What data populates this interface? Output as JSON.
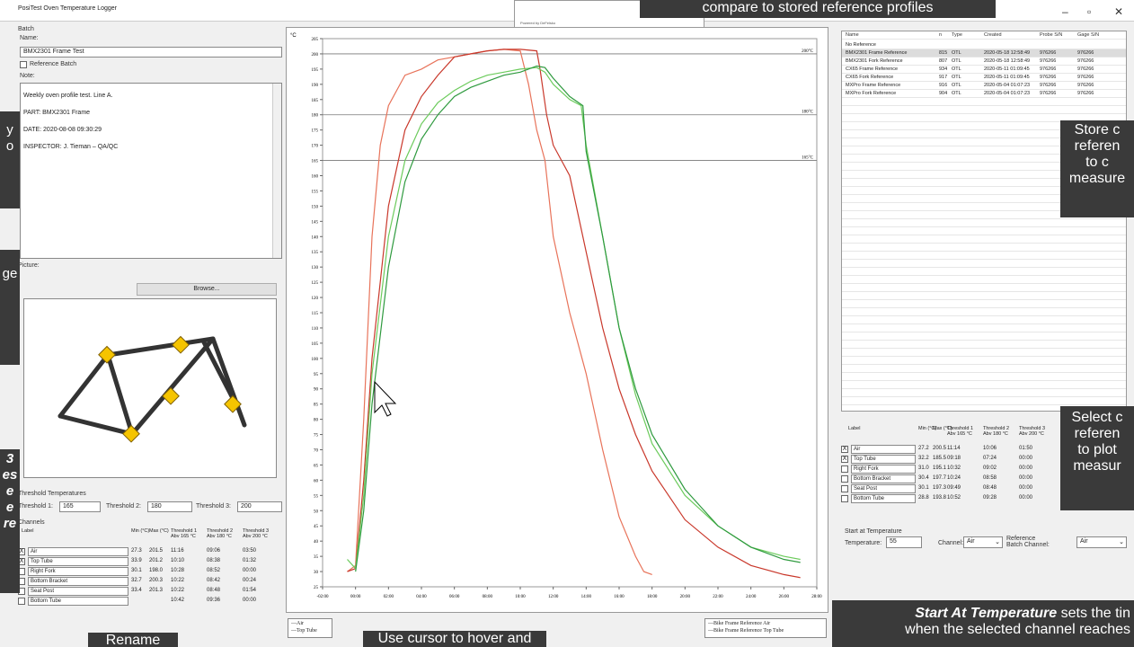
{
  "window": {
    "title": "PosiTest Oven Temperature Logger",
    "min": "–",
    "max": "▫",
    "close": "✕"
  },
  "batch": {
    "group": "Batch",
    "name_label": "Name:",
    "name_value": "BMX2301 Frame Test",
    "reference_batch_label": "Reference Batch",
    "note_label": "Note:",
    "note_lines": [
      "Weekly oven profile test. Line A.",
      "PART: BMX2301 Frame",
      "DATE: 2020-08-08  09:30:29",
      "INSPECTOR: J. Tieman – QA/QC"
    ],
    "picture_label": "Picture:",
    "browse_label": "Browse..."
  },
  "thresholds": {
    "group": "Threshold Temperatures",
    "t1_label": "Threshold 1:",
    "t1_value": "165",
    "t2_label": "Threshold 2:",
    "t2_value": "180",
    "t3_label": "Threshold 3:",
    "t3_value": "200"
  },
  "channels": {
    "group": "Channels",
    "headers": [
      "Label",
      "Min (°C)",
      "Max (°C)",
      "Threshold 1 Abv 165 °C",
      "Threshold 2 Abv 180 °C",
      "Threshold 3 Abv 200 °C"
    ],
    "rows": [
      {
        "checked": "X",
        "label": "Air",
        "min": "27.3",
        "max": "201.5",
        "t1": "11:16",
        "t2": "09:06",
        "t3": "03:50"
      },
      {
        "checked": "X",
        "label": "Top Tube",
        "min": "33.9",
        "max": "201.2",
        "t1": "10:10",
        "t2": "08:38",
        "t3": "01:32"
      },
      {
        "checked": "",
        "label": "Right Fork",
        "min": "30.1",
        "max": "198.0",
        "t1": "10:28",
        "t2": "08:52",
        "t3": "00:00"
      },
      {
        "checked": "",
        "label": "Bottom Bracket",
        "min": "32.7",
        "max": "200.3",
        "t1": "10:22",
        "t2": "08:42",
        "t3": "00:24"
      },
      {
        "checked": "",
        "label": "Seat Post",
        "min": "33.4",
        "max": "201.3",
        "t1": "10:22",
        "t2": "08:48",
        "t3": "01:54"
      },
      {
        "checked": "",
        "label": "Bottom Tube",
        "min": "",
        "max": "",
        "t1": "10:42",
        "t2": "09:36",
        "t3": "00:00"
      }
    ]
  },
  "chart": {
    "ylabel": "°C",
    "threshold_labels": [
      "200°C",
      "180°C",
      "165°C"
    ],
    "legend_left": [
      "—Air",
      "—Top Tube"
    ],
    "legend_right": [
      "—Bike Frame Reference Air",
      "—Bike Frame Reference Top Tube"
    ],
    "top_strip_text": "Powered by DeFelsko"
  },
  "chart_data": {
    "type": "line",
    "xlabel": "",
    "ylabel": "°C",
    "x_ticks": [
      "-02:00",
      "00:00",
      "02:00",
      "04:00",
      "06:00",
      "08:00",
      "10:00",
      "12:00",
      "14:00",
      "16:00",
      "18:00",
      "20:00",
      "22:00",
      "24:00",
      "26:00",
      "28:00"
    ],
    "y_ticks": [
      25,
      30,
      35,
      40,
      45,
      50,
      55,
      60,
      65,
      70,
      75,
      80,
      85,
      90,
      95,
      100,
      105,
      110,
      115,
      120,
      125,
      130,
      135,
      140,
      145,
      150,
      155,
      160,
      165,
      170,
      175,
      180,
      185,
      190,
      195,
      200,
      205
    ],
    "xlim": [
      -2,
      28
    ],
    "ylim": [
      25,
      205
    ],
    "thresholds": [
      200,
      180,
      165
    ],
    "series": [
      {
        "color": "#e8735a",
        "x": [
          -0.5,
          0,
          0.5,
          1,
          1.5,
          2,
          2.5,
          3,
          4,
          5,
          6,
          7,
          8,
          9,
          10,
          10.5,
          11,
          11.5,
          12,
          13,
          14,
          15,
          16,
          17,
          17.5,
          18
        ],
        "y": [
          30,
          32,
          80,
          140,
          170,
          183,
          188,
          193,
          195,
          198,
          199,
          200,
          201,
          201.5,
          201,
          190,
          175,
          165,
          140,
          115,
          95,
          70,
          48,
          35,
          30,
          29
        ]
      },
      {
        "color": "#c9382b",
        "x": [
          -0.5,
          0,
          0.5,
          1,
          2,
          3,
          4,
          5,
          6,
          7,
          8,
          9,
          10,
          11,
          11.2,
          11.6,
          12,
          13,
          14,
          15,
          16,
          17,
          18,
          20,
          22,
          24,
          26,
          27
        ],
        "y": [
          30,
          31,
          60,
          100,
          150,
          175,
          186,
          193,
          199,
          200,
          201,
          201.5,
          201.5,
          201,
          195,
          180,
          170,
          160,
          135,
          110,
          90,
          75,
          63,
          47,
          38,
          32,
          29,
          28
        ]
      },
      {
        "color": "#6ccb5c",
        "x": [
          -0.5,
          0,
          0.5,
          1,
          2,
          3,
          4,
          5,
          6,
          7,
          8,
          9,
          10,
          11,
          11.5,
          12,
          13,
          13.7,
          14,
          15,
          16,
          17,
          18,
          20,
          22,
          24,
          26,
          27
        ],
        "y": [
          34,
          31,
          55,
          95,
          140,
          165,
          177,
          184,
          188,
          191,
          193,
          194,
          195,
          195.5,
          194,
          190,
          185,
          183,
          170,
          140,
          110,
          88,
          72,
          55,
          45,
          38,
          35,
          34
        ]
      },
      {
        "color": "#2e9a3e",
        "x": [
          0,
          0.5,
          1,
          2,
          3,
          4,
          5,
          6,
          7,
          8,
          9,
          10,
          11,
          11.5,
          12,
          13,
          13.8,
          14,
          15,
          16,
          17,
          18,
          20,
          22,
          24,
          26,
          27
        ],
        "y": [
          30,
          50,
          85,
          130,
          158,
          172,
          180,
          186,
          189,
          191,
          193,
          194,
          196,
          195.5,
          192,
          186,
          183,
          168,
          140,
          110,
          90,
          75,
          57,
          45,
          38,
          34,
          33
        ]
      }
    ]
  },
  "references": {
    "headers": [
      "Name",
      "n",
      "Type",
      "Created",
      "Probe S/N",
      "Gage S/N"
    ],
    "rows": [
      {
        "name": "No Reference",
        "n": "",
        "type": "",
        "created": "",
        "probe": "",
        "gage": ""
      },
      {
        "name": "BMX2301 Frame Reference",
        "n": "815",
        "type": "OTL",
        "created": "2020-05-18 12:58:49",
        "probe": "976266",
        "gage": "976266"
      },
      {
        "name": "BMX2301 Fork Reference",
        "n": "807",
        "type": "OTL",
        "created": "2020-05-18 12:58:49",
        "probe": "976266",
        "gage": "976266"
      },
      {
        "name": "CX65 Frame Reference",
        "n": "934",
        "type": "OTL",
        "created": "2020-05-11 01:09:45",
        "probe": "976266",
        "gage": "976266"
      },
      {
        "name": "CX65 Fork Reference",
        "n": "917",
        "type": "OTL",
        "created": "2020-05-11 01:09:45",
        "probe": "976266",
        "gage": "976266"
      },
      {
        "name": "MXPro Frame Reference",
        "n": "916",
        "type": "OTL",
        "created": "2020-05-04 01:07:23",
        "probe": "976266",
        "gage": "976266"
      },
      {
        "name": "MXPro Fork Reference",
        "n": "904",
        "type": "OTL",
        "created": "2020-05-04 01:07:23",
        "probe": "976266",
        "gage": "976266"
      }
    ]
  },
  "ref_channels": {
    "headers": [
      "Label",
      "Min (°C)",
      "Max (°C)",
      "Threshold 1 Abv 165 °C",
      "Threshold 2 Abv 180 °C",
      "Threshold 3 Abv 200 °C"
    ],
    "rows": [
      {
        "checked": "X",
        "label": "Air",
        "min": "27.2",
        "max": "200.5",
        "t1": "11:14",
        "t2": "10:06",
        "t3": "01:50"
      },
      {
        "checked": "X",
        "label": "Top Tube",
        "min": "32.2",
        "max": "185.5",
        "t1": "09:18",
        "t2": "07:24",
        "t3": "00:00"
      },
      {
        "checked": "",
        "label": "Right Fork",
        "min": "31.0",
        "max": "195.1",
        "t1": "10:32",
        "t2": "09:02",
        "t3": "00:00"
      },
      {
        "checked": "",
        "label": "Bottom Bracket",
        "min": "30.4",
        "max": "197.7",
        "t1": "10:24",
        "t2": "08:58",
        "t3": "00:00"
      },
      {
        "checked": "",
        "label": "Seat Post",
        "min": "30.1",
        "max": "197.3",
        "t1": "09:49",
        "t2": "08:48",
        "t3": "00:00"
      },
      {
        "checked": "",
        "label": "Bottom Tube",
        "min": "28.8",
        "max": "193.8",
        "t1": "10:52",
        "t2": "09:28",
        "t3": "00:00"
      }
    ]
  },
  "start_temp": {
    "group": "Start at Temperature",
    "temp_label": "Temperature:",
    "temp_value": "55",
    "channel_label": "Channel:",
    "channel_value": "Air",
    "ref_channel_label": "Reference Batch Channel:",
    "ref_channel_value": "Air"
  },
  "overlays": {
    "top_center": "compare to stored reference profiles",
    "left1": "y\no",
    "left2": "ge",
    "left3": "3\nes\ne\ne\nre",
    "right1": "Store c\nreferen\nto c\nmeasure",
    "right2": "Select c\nreferen\nto plot\nmeasur",
    "bottom_left": "Rename",
    "bottom_center": "Use cursor to hover and",
    "bottom_right_bold": "Start At Temperature",
    "bottom_right_rest": " sets the tin",
    "bottom_right_line2": "when the selected channel reaches"
  }
}
